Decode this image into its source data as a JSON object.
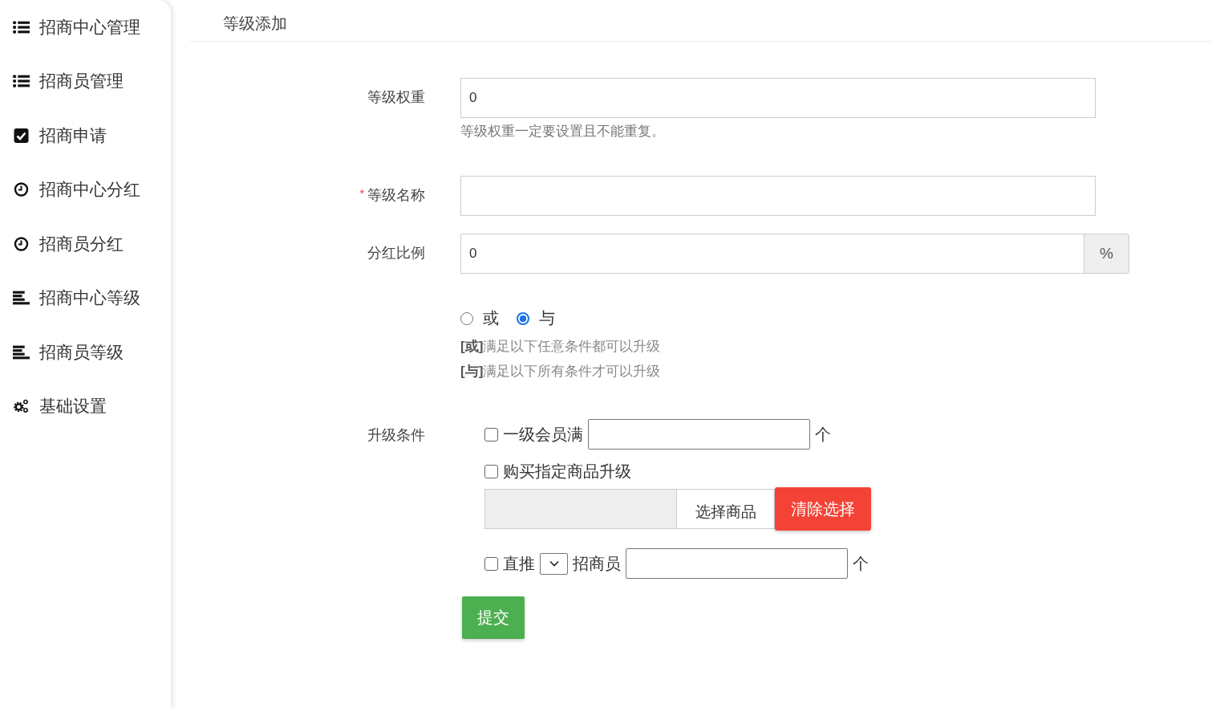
{
  "sidebar": {
    "items": [
      {
        "label": "招商中心管理",
        "kind": "list",
        "selected": false
      },
      {
        "label": "招商员管理",
        "kind": "list",
        "selected": false
      },
      {
        "label": "招商申请",
        "kind": "check",
        "selected": false
      },
      {
        "label": "招商中心分红",
        "kind": "clock",
        "selected": false
      },
      {
        "label": "招商员分红",
        "kind": "clock",
        "selected": false
      },
      {
        "label": "招商中心等级",
        "kind": "align",
        "selected": false
      },
      {
        "label": "招商员等级",
        "kind": "align",
        "selected": false
      },
      {
        "label": "基础设置",
        "kind": "gears",
        "selected": false
      }
    ]
  },
  "header": {
    "title": "等级添加"
  },
  "form": {
    "weight": {
      "label": "等级权重",
      "value": "0",
      "help": "等级权重一定要设置且不能重复。"
    },
    "name": {
      "label": "等级名称",
      "required_mark": "*"
    },
    "ratio": {
      "label": "分红比例",
      "value": "0",
      "addon": "%"
    },
    "logic": {
      "options": [
        {
          "label": "或",
          "selected": false
        },
        {
          "label": "与",
          "selected": true
        }
      ],
      "help": [
        "**[或]**满足以下任意条件都可以升级",
        "**[与]**满足以下所有条件才可以升级"
      ]
    },
    "conditions": {
      "label": "升级条件",
      "items": [
        {
          "kind": "count",
          "label": "一级会员满",
          "unit": "个",
          "checked": false
        },
        {
          "kind": "goods",
          "label": "购买指定商品升级",
          "checked": false,
          "select_button": "选择商品",
          "clear_button": "清除选择"
        },
        {
          "kind": "direct",
          "label": "直推",
          "label2": "招商员",
          "unit": "个",
          "checked": false
        }
      ]
    },
    "submit": "提交"
  }
}
